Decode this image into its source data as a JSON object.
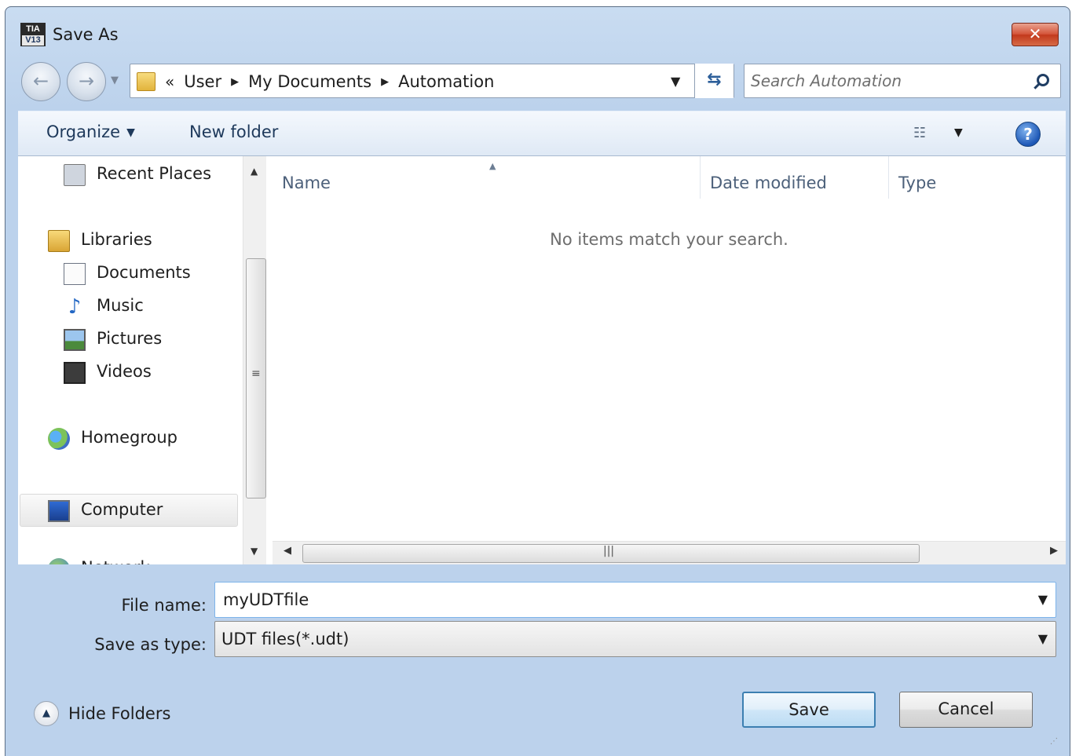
{
  "window": {
    "title": "Save As",
    "app_icon_top": "TIA",
    "app_icon_bottom": "V13",
    "close_symbol": "✕"
  },
  "address_bar": {
    "overflow_symbol": "«",
    "crumbs": [
      "User",
      "My Documents",
      "Automation"
    ],
    "separator": "▶",
    "refresh_icon": "refresh-icon"
  },
  "search": {
    "placeholder": "Search Automation"
  },
  "toolbar": {
    "organize_label": "Organize",
    "new_folder_label": "New folder",
    "help_symbol": "?"
  },
  "nav_pane": {
    "items": [
      {
        "label": "Recent Places",
        "icon": "recent-places-icon"
      },
      {
        "label": "Libraries",
        "icon": "libraries-icon"
      },
      {
        "label": "Documents",
        "icon": "documents-icon"
      },
      {
        "label": "Music",
        "icon": "music-icon"
      },
      {
        "label": "Pictures",
        "icon": "pictures-icon"
      },
      {
        "label": "Videos",
        "icon": "videos-icon"
      },
      {
        "label": "Homegroup",
        "icon": "homegroup-icon"
      },
      {
        "label": "Computer",
        "icon": "computer-icon"
      },
      {
        "label": "Network",
        "icon": "network-icon"
      }
    ],
    "selected": "Computer"
  },
  "file_list": {
    "columns": [
      "Name",
      "Date modified",
      "Type"
    ],
    "sorted_by": "Name",
    "empty_message": "No items match your search.",
    "rows": []
  },
  "form": {
    "file_name_label": "File name:",
    "file_name_value": "myUDTfile",
    "save_type_label": "Save as type:",
    "save_type_value": "UDT files(*.udt)"
  },
  "footer": {
    "hide_folders_label": "Hide Folders",
    "save_label": "Save",
    "cancel_label": "Cancel"
  }
}
